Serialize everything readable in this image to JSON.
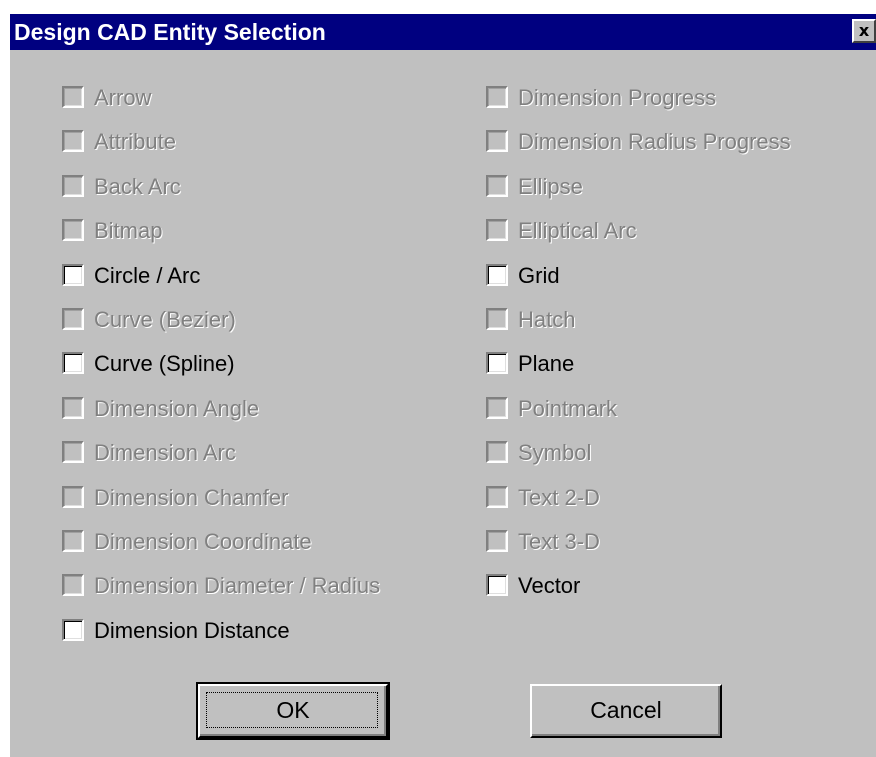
{
  "window": {
    "title": "Design CAD Entity Selection",
    "close_symbol": "x"
  },
  "entities_left": [
    {
      "label": "Arrow",
      "enabled": false,
      "checked": false
    },
    {
      "label": "Attribute",
      "enabled": false,
      "checked": false
    },
    {
      "label": "Back Arc",
      "enabled": false,
      "checked": false
    },
    {
      "label": "Bitmap",
      "enabled": false,
      "checked": false
    },
    {
      "label": "Circle / Arc",
      "enabled": true,
      "checked": false
    },
    {
      "label": "Curve (Bezier)",
      "enabled": false,
      "checked": false
    },
    {
      "label": "Curve (Spline)",
      "enabled": true,
      "checked": false
    },
    {
      "label": "Dimension Angle",
      "enabled": false,
      "checked": false
    },
    {
      "label": "Dimension Arc",
      "enabled": false,
      "checked": false
    },
    {
      "label": "Dimension Chamfer",
      "enabled": false,
      "checked": false
    },
    {
      "label": "Dimension Coordinate",
      "enabled": false,
      "checked": false
    },
    {
      "label": "Dimension Diameter / Radius",
      "enabled": false,
      "checked": false
    },
    {
      "label": "Dimension Distance",
      "enabled": true,
      "checked": false
    }
  ],
  "entities_right": [
    {
      "label": "Dimension Progress",
      "enabled": false,
      "checked": false
    },
    {
      "label": "Dimension Radius Progress",
      "enabled": false,
      "checked": false
    },
    {
      "label": "Ellipse",
      "enabled": false,
      "checked": false
    },
    {
      "label": "Elliptical Arc",
      "enabled": false,
      "checked": false
    },
    {
      "label": "Grid",
      "enabled": true,
      "checked": false
    },
    {
      "label": "Hatch",
      "enabled": false,
      "checked": false
    },
    {
      "label": "Plane",
      "enabled": true,
      "checked": false
    },
    {
      "label": "Pointmark",
      "enabled": false,
      "checked": false
    },
    {
      "label": "Symbol",
      "enabled": false,
      "checked": false
    },
    {
      "label": "Text 2-D",
      "enabled": false,
      "checked": false
    },
    {
      "label": "Text 3-D",
      "enabled": false,
      "checked": false
    },
    {
      "label": "Vector",
      "enabled": true,
      "checked": false
    }
  ],
  "buttons": {
    "ok": "OK",
    "cancel": "Cancel"
  },
  "colors": {
    "title_bar": "#000080",
    "dialog_face": "#c0c0c0",
    "disabled_text": "#808080"
  }
}
